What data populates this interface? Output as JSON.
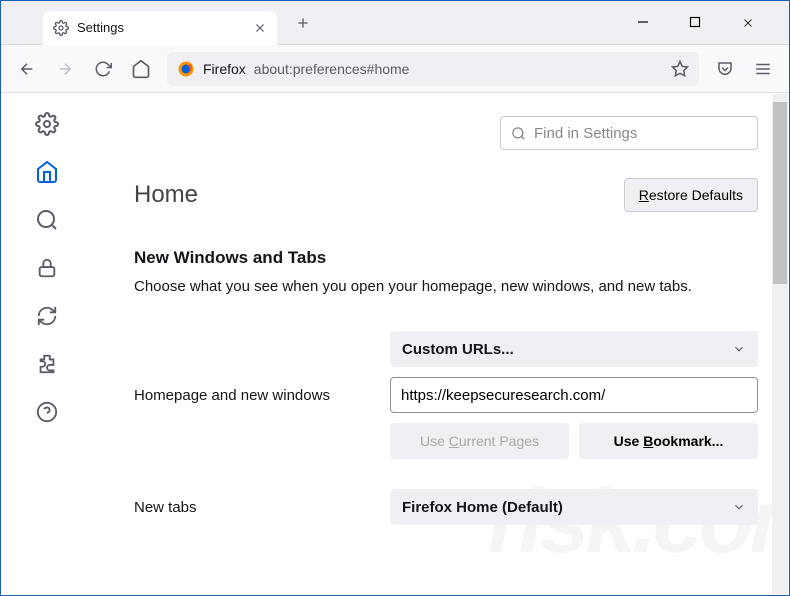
{
  "tab": {
    "title": "Settings"
  },
  "urlbar": {
    "prefix": "Firefox",
    "path": "about:preferences#home"
  },
  "search": {
    "placeholder": "Find in Settings"
  },
  "page": {
    "title": "Home",
    "restore": "Restore Defaults",
    "section": "New Windows and Tabs",
    "desc": "Choose what you see when you open your homepage, new windows, and new tabs."
  },
  "form": {
    "select1": "Custom URLs...",
    "label_home": "Homepage and new windows",
    "url_value": "https://keepsecuresearch.com/",
    "use_current": "Use Current Pages",
    "use_bookmark": "Use Bookmark...",
    "label_newtabs": "New tabs",
    "select2": "Firefox Home (Default)"
  }
}
